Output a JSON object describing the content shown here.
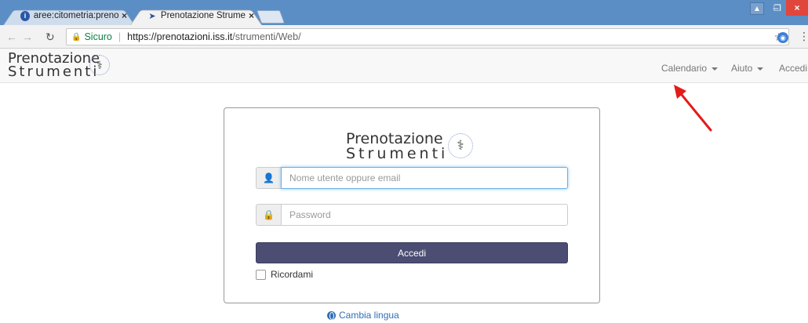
{
  "browser": {
    "tabs": [
      {
        "title": "aree:citometria:prenotazi",
        "active": false
      },
      {
        "title": "Prenotazione Strumenti -",
        "active": true
      }
    ],
    "close_glyph": "×",
    "secure_label": "Sicuro",
    "url_host": "https://prenotazioni.iss.it",
    "url_path": "/strumenti/Web/"
  },
  "site": {
    "brand_line1": "Prenotazione",
    "brand_line2": "Strumenti",
    "nav": {
      "calendar": "Calendario",
      "help": "Aiuto",
      "login": "Accedi"
    }
  },
  "login": {
    "username_placeholder": "Nome utente oppure email",
    "password_placeholder": "Password",
    "submit_label": "Accedi",
    "remember_label": "Ricordami"
  },
  "footer": {
    "language_link": "Cambia lingua"
  },
  "colors": {
    "submit_bg": "#4b4d72",
    "annotation_arrow": "#e31b1b",
    "link": "#2f6fb5"
  },
  "icons": {
    "user": "user-icon",
    "lock": "lock-icon",
    "globe": "globe-icon"
  }
}
